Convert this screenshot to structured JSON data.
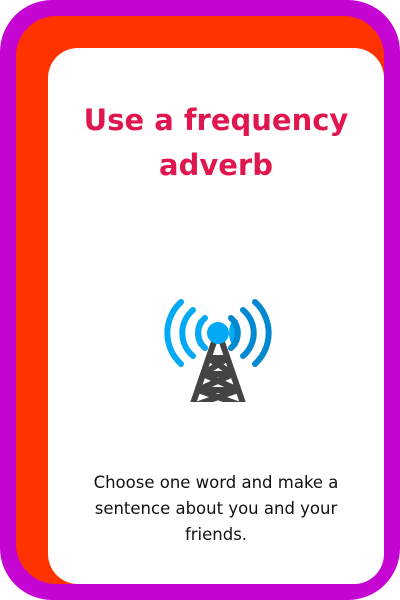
{
  "card": {
    "title": "Use a frequency adverb",
    "icon": "radio-tower-icon",
    "instruction": "Choose one word and make a sentence about you and your friends.",
    "colors": {
      "outer": "#c506d2",
      "border": "#ff3300",
      "title": "#e0164f",
      "signal": "#03a9f4",
      "tower": "#444444",
      "base": "#1cc46a"
    }
  }
}
